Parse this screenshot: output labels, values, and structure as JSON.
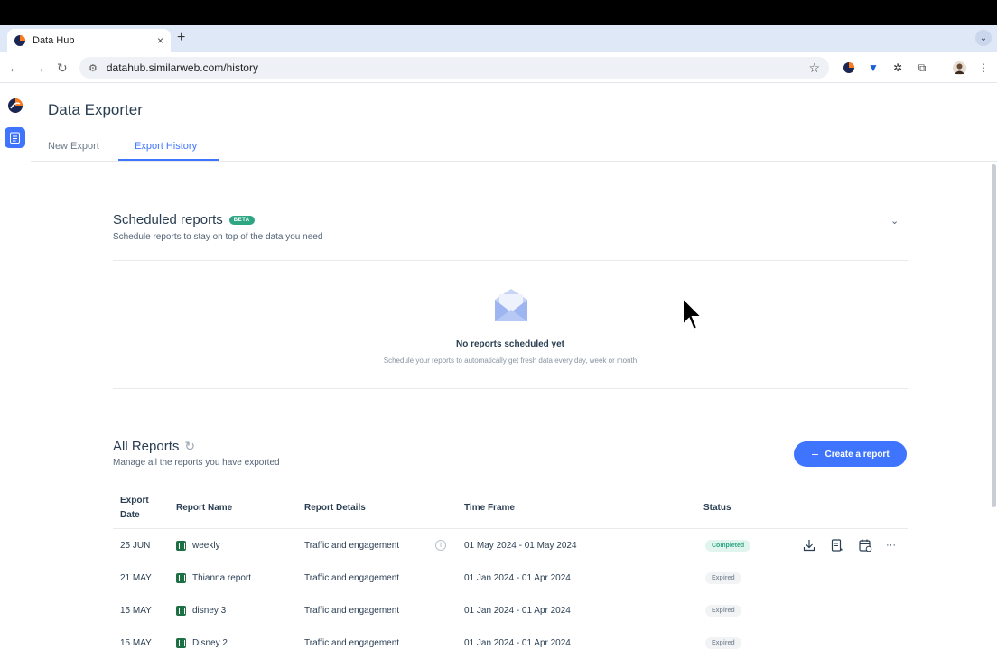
{
  "browser": {
    "tab_title": "Data Hub",
    "tab_close": "×",
    "new_tab": "+",
    "tabs_menu": "⌄",
    "url": "datahub.similarweb.com/history",
    "back": "←",
    "forward": "→",
    "reload": "↻",
    "star": "☆",
    "menu": "⋮"
  },
  "app": {
    "title": "Data Exporter",
    "tabs": [
      {
        "label": "New Export",
        "active": false
      },
      {
        "label": "Export History",
        "active": true
      }
    ]
  },
  "scheduled": {
    "title": "Scheduled reports",
    "badge": "BETA",
    "subtitle": "Schedule reports to stay on top of the data you need",
    "chevron": "⌄",
    "empty_title": "No reports scheduled yet",
    "empty_subtitle": "Schedule your reports to automatically get fresh data every day, week or month"
  },
  "reports": {
    "title": "All Reports",
    "refresh_icon": "↻",
    "subtitle": "Manage all the reports you have exported",
    "create_button": "Create a report",
    "create_plus": "+",
    "columns": {
      "date_line1": "Export",
      "date_line2": "Date",
      "name": "Report Name",
      "details": "Report Details",
      "timeframe": "Time Frame",
      "status": "Status"
    },
    "rows": [
      {
        "date": "25 JUN",
        "name": "weekly",
        "details": "Traffic and engagement",
        "timeframe": "01 May 2024 - 01 May 2024",
        "status": "Completed"
      },
      {
        "date": "21 MAY",
        "name": "Thianna report",
        "details": "Traffic and engagement",
        "timeframe": "01 Jan 2024 - 01 Apr 2024",
        "status": "Expired"
      },
      {
        "date": "15 MAY",
        "name": "disney 3",
        "details": "Traffic and engagement",
        "timeframe": "01 Jan 2024 - 01 Apr 2024",
        "status": "Expired"
      },
      {
        "date": "15 MAY",
        "name": "Disney 2",
        "details": "Traffic and engagement",
        "timeframe": "01 Jan 2024 - 01 Apr 2024",
        "status": "Expired"
      }
    ],
    "info_glyph": "i",
    "more_glyph": "···"
  },
  "colors": {
    "accent": "#3e74fe",
    "success": "#2ea684",
    "text": "#2a3e52",
    "excel": "#1d7044"
  },
  "icons": [
    "similarweb-logo-icon",
    "report-icon",
    "mail-illustration-icon",
    "download-icon",
    "edit-report-icon",
    "schedule-icon",
    "more-icon",
    "info-icon",
    "excel-icon",
    "refresh-icon",
    "cursor-icon"
  ]
}
